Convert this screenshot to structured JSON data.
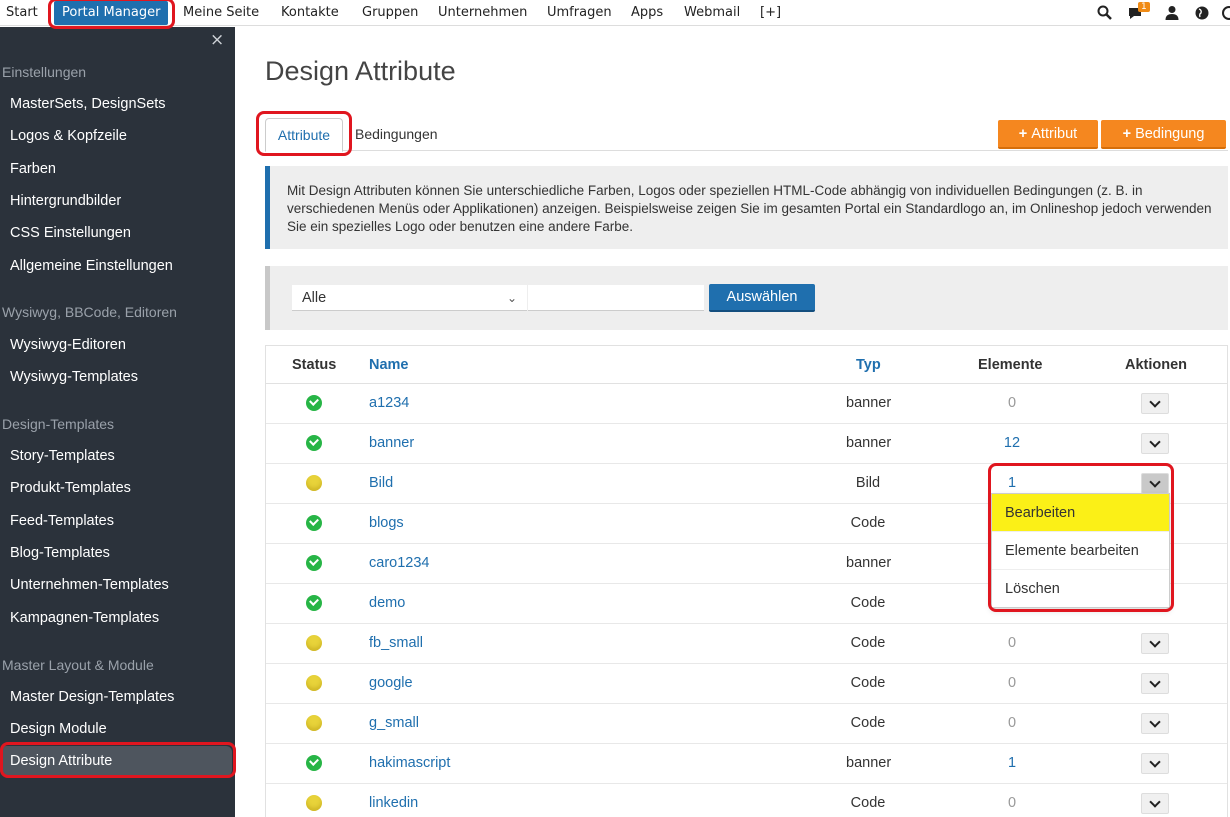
{
  "topnav": {
    "items": [
      {
        "label": "Start"
      },
      {
        "label": "Portal Manager"
      },
      {
        "label": "Meine Seite"
      },
      {
        "label": "Kontakte"
      },
      {
        "label": "Gruppen"
      },
      {
        "label": "Unternehmen"
      },
      {
        "label": "Umfragen"
      },
      {
        "label": "Apps"
      },
      {
        "label": "Webmail"
      },
      {
        "label": "[+]"
      }
    ],
    "message_badge": "1"
  },
  "sidebar": {
    "close_symbol": "×",
    "sections": [
      {
        "title": "Einstellungen",
        "items": [
          "MasterSets, DesignSets",
          "Logos & Kopfzeile",
          "Farben",
          "Hintergrundbilder",
          "CSS Einstellungen",
          "Allgemeine Einstellungen"
        ]
      },
      {
        "title": "Wysiwyg, BBCode, Editoren",
        "items": [
          "Wysiwyg-Editoren",
          "Wysiwyg-Templates"
        ]
      },
      {
        "title": "Design-Templates",
        "items": [
          "Story-Templates",
          "Produkt-Templates",
          "Feed-Templates",
          "Blog-Templates",
          "Unternehmen-Templates",
          "Kampagnen-Templates"
        ]
      },
      {
        "title": "Master Layout & Module",
        "items": [
          "Master Design-Templates",
          "Design Module",
          "Design Attribute"
        ]
      }
    ]
  },
  "main": {
    "title": "Design Attribute",
    "tabs": [
      {
        "label": "Attribute"
      },
      {
        "label": "Bedingungen"
      }
    ],
    "buttons": {
      "add_attribute": "Attribut",
      "add_condition": "Bedingung",
      "plus": "+"
    },
    "info_text": "Mit Design Attributen können Sie unterschiedliche Farben, Logos oder speziellen HTML-Code abhängig von individuellen Bedingungen (z. B. in verschiedenen Menüs oder Applikationen) anzeigen. Beispielsweise zeigen Sie im gesamten Portal ein Standardlogo an, im Onlineshop jedoch verwenden Sie ein spezielles Logo oder benutzen eine andere Farbe.",
    "filter": {
      "select_value": "Alle",
      "input_value": "",
      "submit_label": "Auswählen"
    }
  },
  "table": {
    "headers": {
      "status": "Status",
      "name": "Name",
      "typ": "Typ",
      "elemente": "Elemente",
      "aktionen": "Aktionen"
    },
    "rows": [
      {
        "status": "ok",
        "name": "a1234",
        "typ": "banner",
        "elemente": "0"
      },
      {
        "status": "ok",
        "name": "banner",
        "typ": "banner",
        "elemente": "12"
      },
      {
        "status": "warn",
        "name": "Bild",
        "typ": "Bild",
        "elemente": "1"
      },
      {
        "status": "ok",
        "name": "blogs",
        "typ": "Code",
        "elemente": ""
      },
      {
        "status": "ok",
        "name": "caro1234",
        "typ": "banner",
        "elemente": ""
      },
      {
        "status": "ok",
        "name": "demo",
        "typ": "Code",
        "elemente": ""
      },
      {
        "status": "warn",
        "name": "fb_small",
        "typ": "Code",
        "elemente": "0"
      },
      {
        "status": "warn",
        "name": "google",
        "typ": "Code",
        "elemente": "0"
      },
      {
        "status": "warn",
        "name": "g_small",
        "typ": "Code",
        "elemente": "0"
      },
      {
        "status": "ok",
        "name": "hakimascript",
        "typ": "banner",
        "elemente": "1"
      },
      {
        "status": "warn",
        "name": "linkedin",
        "typ": "Code",
        "elemente": "0"
      }
    ]
  },
  "dropdown": {
    "items": [
      {
        "label": "Bearbeiten"
      },
      {
        "label": "Elemente bearbeiten"
      },
      {
        "label": "Löschen"
      }
    ]
  },
  "colors": {
    "primary": "#1f6fae",
    "accent": "#f5871f",
    "sidebar": "#2b323b",
    "highlight": "#fbf017",
    "annotation": "#e0161f"
  }
}
